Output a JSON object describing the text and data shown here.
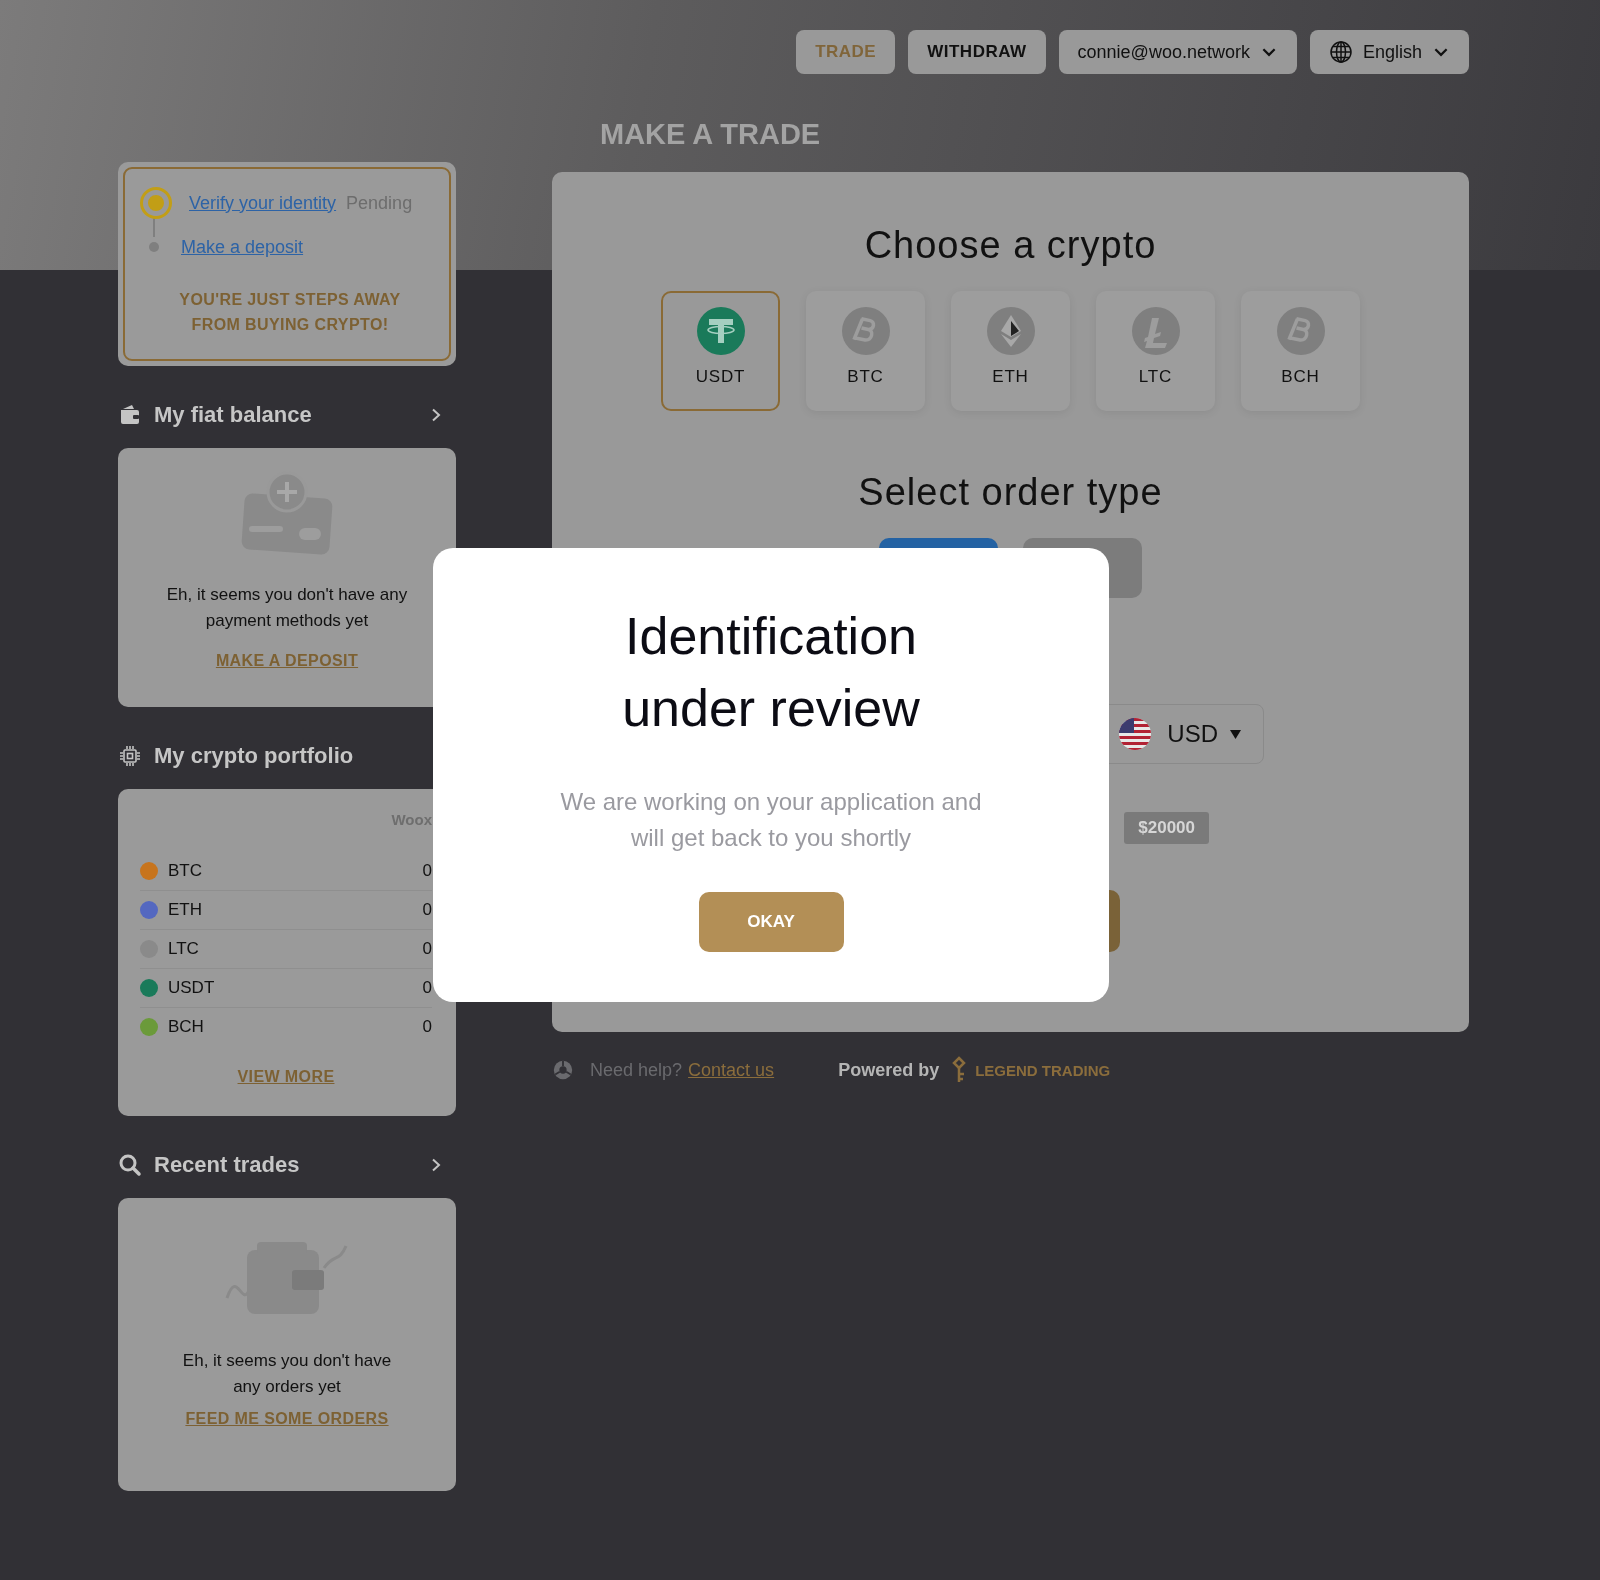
{
  "header": {
    "nav": [
      {
        "label": "TRADE",
        "selected": true
      },
      {
        "label": "WITHDRAW",
        "selected": false
      }
    ],
    "account": "connie@woo.network",
    "language": "English"
  },
  "page_title": "MAKE A TRADE",
  "onboarding": {
    "steps": [
      {
        "label": "Verify your identity",
        "status": "Pending",
        "active": true
      },
      {
        "label": "Make a deposit",
        "active": false
      }
    ],
    "message": "YOU'RE JUST STEPS AWAY FROM BUYING CRYPTO!"
  },
  "fiat_balance": {
    "title": "My fiat balance",
    "navigable": true,
    "empty_text": "Eh, it seems you don't have any payment methods yet",
    "action": "MAKE A DEPOSIT"
  },
  "portfolio": {
    "title": "My crypto portfolio",
    "navigable": false,
    "column_header": "Woox",
    "rows": [
      {
        "symbol": "BTC",
        "amount": "0",
        "color": "#c7741d"
      },
      {
        "symbol": "ETH",
        "amount": "0",
        "color": "#5468c0"
      },
      {
        "symbol": "LTC",
        "amount": "0",
        "color": "#8a8a8a"
      },
      {
        "symbol": "USDT",
        "amount": "0",
        "color": "#1a7a5a"
      },
      {
        "symbol": "BCH",
        "amount": "0",
        "color": "#6b9a3a"
      }
    ],
    "action": "VIEW MORE"
  },
  "recent_trades": {
    "title": "Recent trades",
    "navigable": true,
    "empty_text": "Eh, it seems you don't have any orders yet",
    "action": "FEED ME SOME ORDERS"
  },
  "trade": {
    "crypto_title": "Choose a crypto",
    "cryptos": [
      {
        "symbol": "USDT",
        "kind": "tether",
        "selected": true
      },
      {
        "symbol": "BTC",
        "kind": "bitcoin",
        "selected": false
      },
      {
        "symbol": "ETH",
        "kind": "ether",
        "selected": false
      },
      {
        "symbol": "LTC",
        "kind": "litecoin",
        "selected": false
      },
      {
        "symbol": "BCH",
        "kind": "bitcoin",
        "selected": false
      }
    ],
    "order_title": "Select order type",
    "order_types": [
      {
        "selected": true
      },
      {
        "selected": false
      }
    ],
    "currency": "USD",
    "amount_chip": "$20000"
  },
  "footer": {
    "help": "Need help?",
    "contact": "Contact us",
    "powered": "Powered by",
    "brand": "LEGEND TRADING"
  },
  "modal": {
    "title": "Identification under review",
    "message": "We are working on your application and will get back to you shortly",
    "button": "OKAY"
  }
}
